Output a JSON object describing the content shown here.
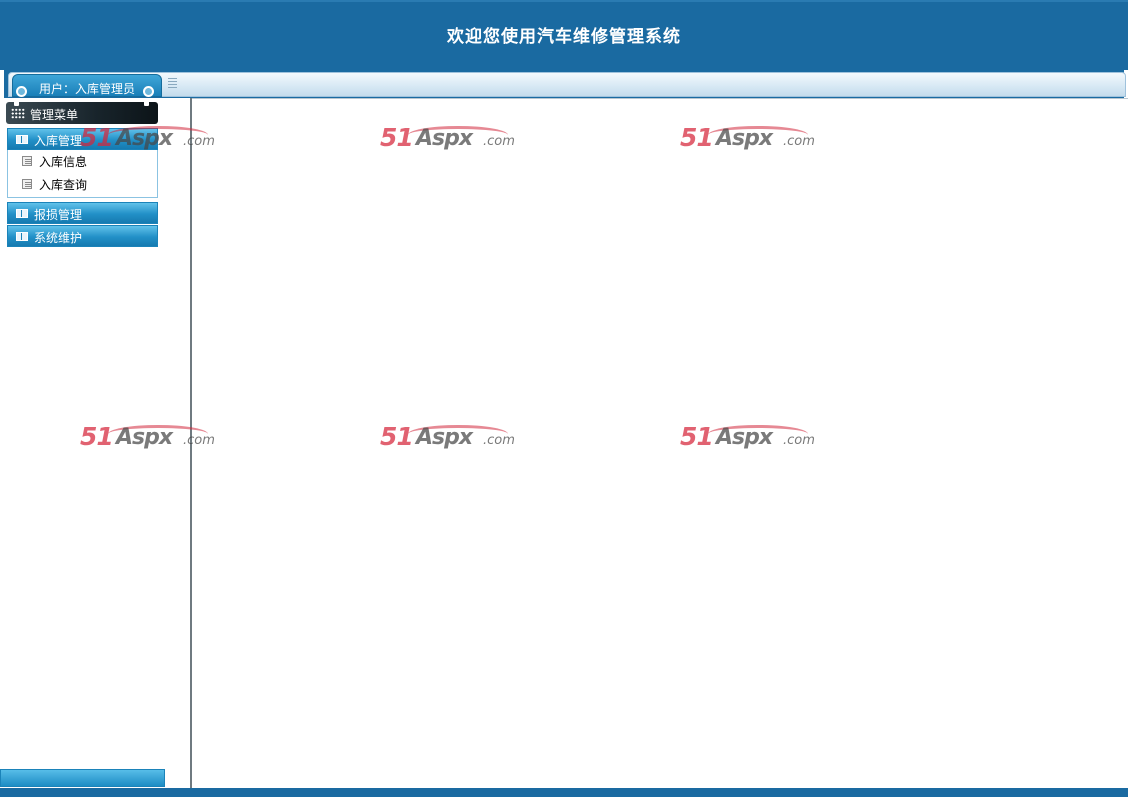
{
  "header": {
    "title": "欢迎您使用汽车维修管理系统"
  },
  "userbar": {
    "user_label": "用户：入库管理员"
  },
  "sidebar": {
    "menu_title": "管理菜单",
    "groups": [
      {
        "label": "入库管理",
        "expanded": true,
        "items": [
          {
            "label": "入库信息"
          },
          {
            "label": "入库查询"
          }
        ]
      },
      {
        "label": "报损管理",
        "expanded": false
      },
      {
        "label": "系统维护",
        "expanded": false
      }
    ]
  },
  "watermark": {
    "number": "51",
    "brand": "Aspx",
    "tld": ".com"
  },
  "colors": {
    "header_blue": "#1a6aa1",
    "group_head_blue": "#2290c7",
    "watermark_red": "#d6263a"
  }
}
